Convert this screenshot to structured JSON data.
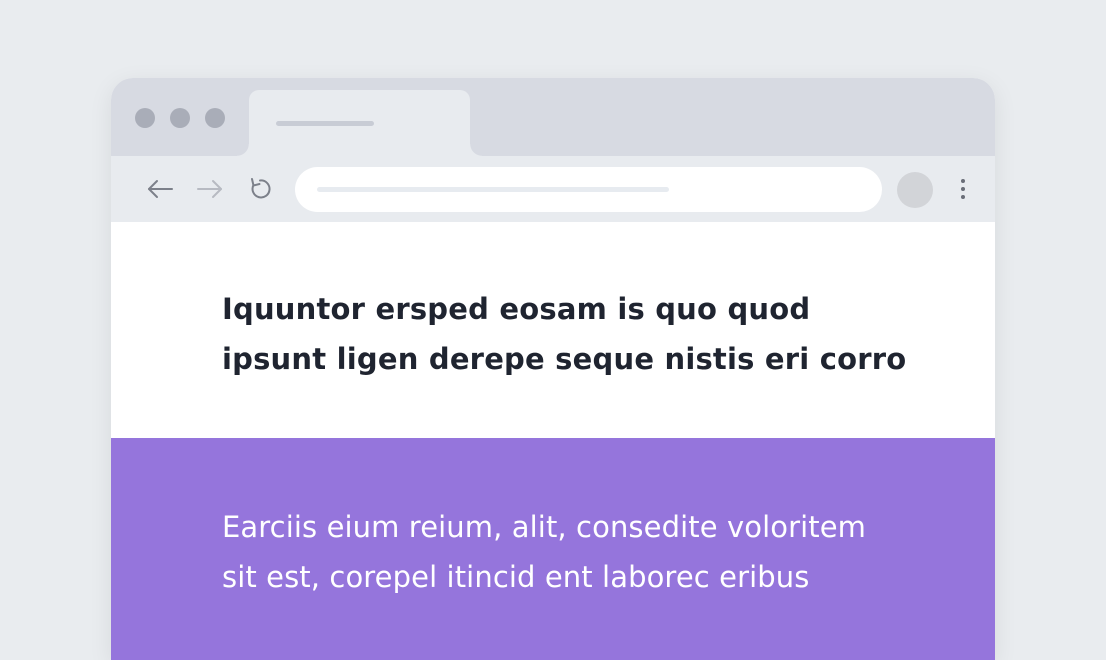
{
  "content": {
    "headline_line1": "Iquuntor ersped eosam is quo quod",
    "headline_line2": "ipsunt ligen derepe seque nistis eri corro",
    "body_line1": "Earciis eium reium, alit, consedite voloritem",
    "body_line2": "sit est, corepel itincid ent laborec eribus"
  },
  "icons": {
    "back": "arrow-left-icon",
    "forward": "arrow-right-icon",
    "reload": "reload-icon",
    "menu": "more-vertical-icon"
  },
  "colors": {
    "page_background": "#e9ecef",
    "tab_bar": "#d7dae2",
    "toolbar": "#e8ebef",
    "accent_section": "#9575dc",
    "headline_text": "#1f2430",
    "body_text": "#ffffff"
  }
}
